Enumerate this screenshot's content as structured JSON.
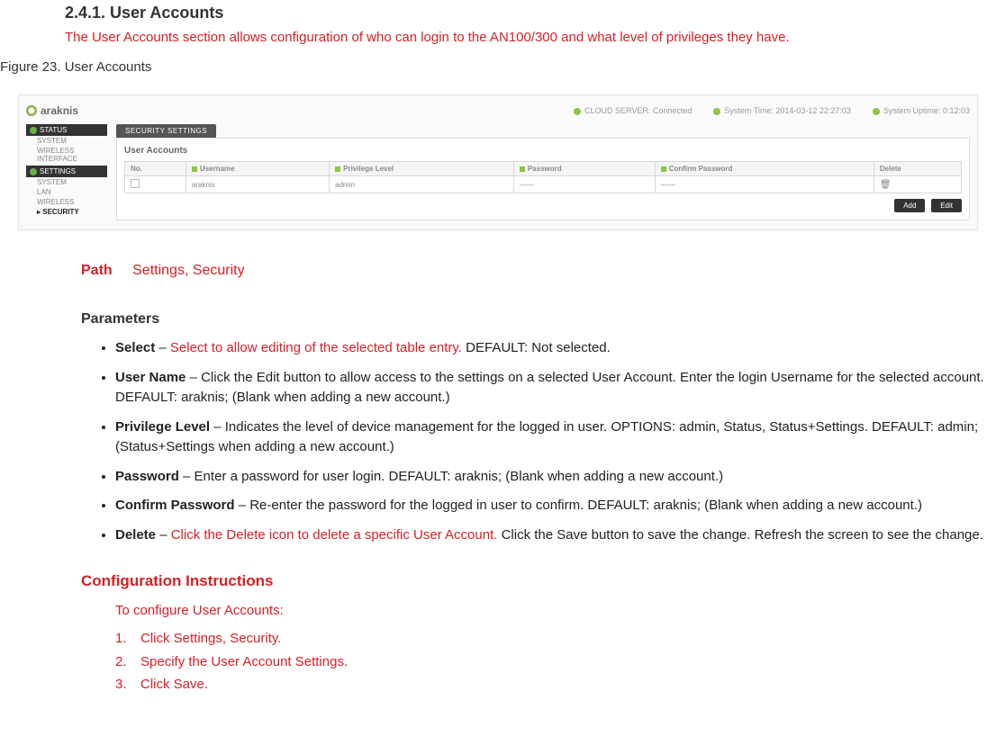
{
  "section": {
    "number_title": "2.4.1. User Accounts",
    "intro": "The User Accounts section allows configuration of who can login to the AN100/300 and what level of privileges they have."
  },
  "figure_caption": "Figure 23. User Accounts",
  "screenshot": {
    "logo_text": "araknis",
    "cloud_server": "CLOUD SERVER:  Connected",
    "system_time": "System Time:  2014-03-12 22:27:03",
    "system_uptime": "System Uptime:  0:12:03",
    "sidebar": {
      "group1": "STATUS",
      "g1_items": [
        "SYSTEM",
        "WIRELESS INTERFACE"
      ],
      "group2": "SETTINGS",
      "g2_items": [
        "SYSTEM",
        "LAN",
        "WIRELESS"
      ],
      "g2_selected": "▸ SECURITY"
    },
    "tab": "SECURITY  SETTINGS",
    "panel_title": "User Accounts",
    "table": {
      "headers": [
        "No.",
        "Username",
        "Privilege Level",
        "Password",
        "Confirm Password",
        "Delete"
      ],
      "row": {
        "no_checkbox": true,
        "username": "araknis",
        "priv": "admin",
        "pw": "——",
        "cpw": "——",
        "delete_icon": "🗑"
      }
    },
    "buttons": {
      "add": "Add",
      "edit": "Edit"
    }
  },
  "path": {
    "label": "Path",
    "value": "Settings, Security"
  },
  "parameters_heading": "Parameters",
  "params": [
    {
      "name": "Select",
      "red": "Select to allow editing of the selected table entry.",
      "rest": " DEFAULT: Not selected."
    },
    {
      "name": "User Name",
      "rest": " – Click the Edit button to allow access to the settings on a selected User Account. Enter the login Username for the selected account. DEFAULT: araknis; (Blank when adding a new account.)"
    },
    {
      "name": "Privilege Level",
      "rest": " – Indicates the level of device management for the logged in user. OPTIONS: admin, Status, Status+Settings. DEFAULT: admin; (Status+Settings when adding a new account.)"
    },
    {
      "name": "Password",
      "rest": " – Enter a password for user login. DEFAULT: araknis; (Blank when adding a new account.)"
    },
    {
      "name": "Confirm Password",
      "rest": " – Re-enter the password for the logged in user to confirm. DEFAULT: araknis; (Blank when adding a new account.)"
    },
    {
      "name": "Delete",
      "red": "Click the Delete icon to delete a specific User Account.",
      "rest": " Click the Save button to save the change. Refresh the screen to see the change."
    }
  ],
  "config_heading": "Configuration Instructions",
  "config_intro": "To configure User Accounts:",
  "config_steps": [
    "Click Settings, Security.",
    "Specify the User Account Settings.",
    "Click Save."
  ]
}
